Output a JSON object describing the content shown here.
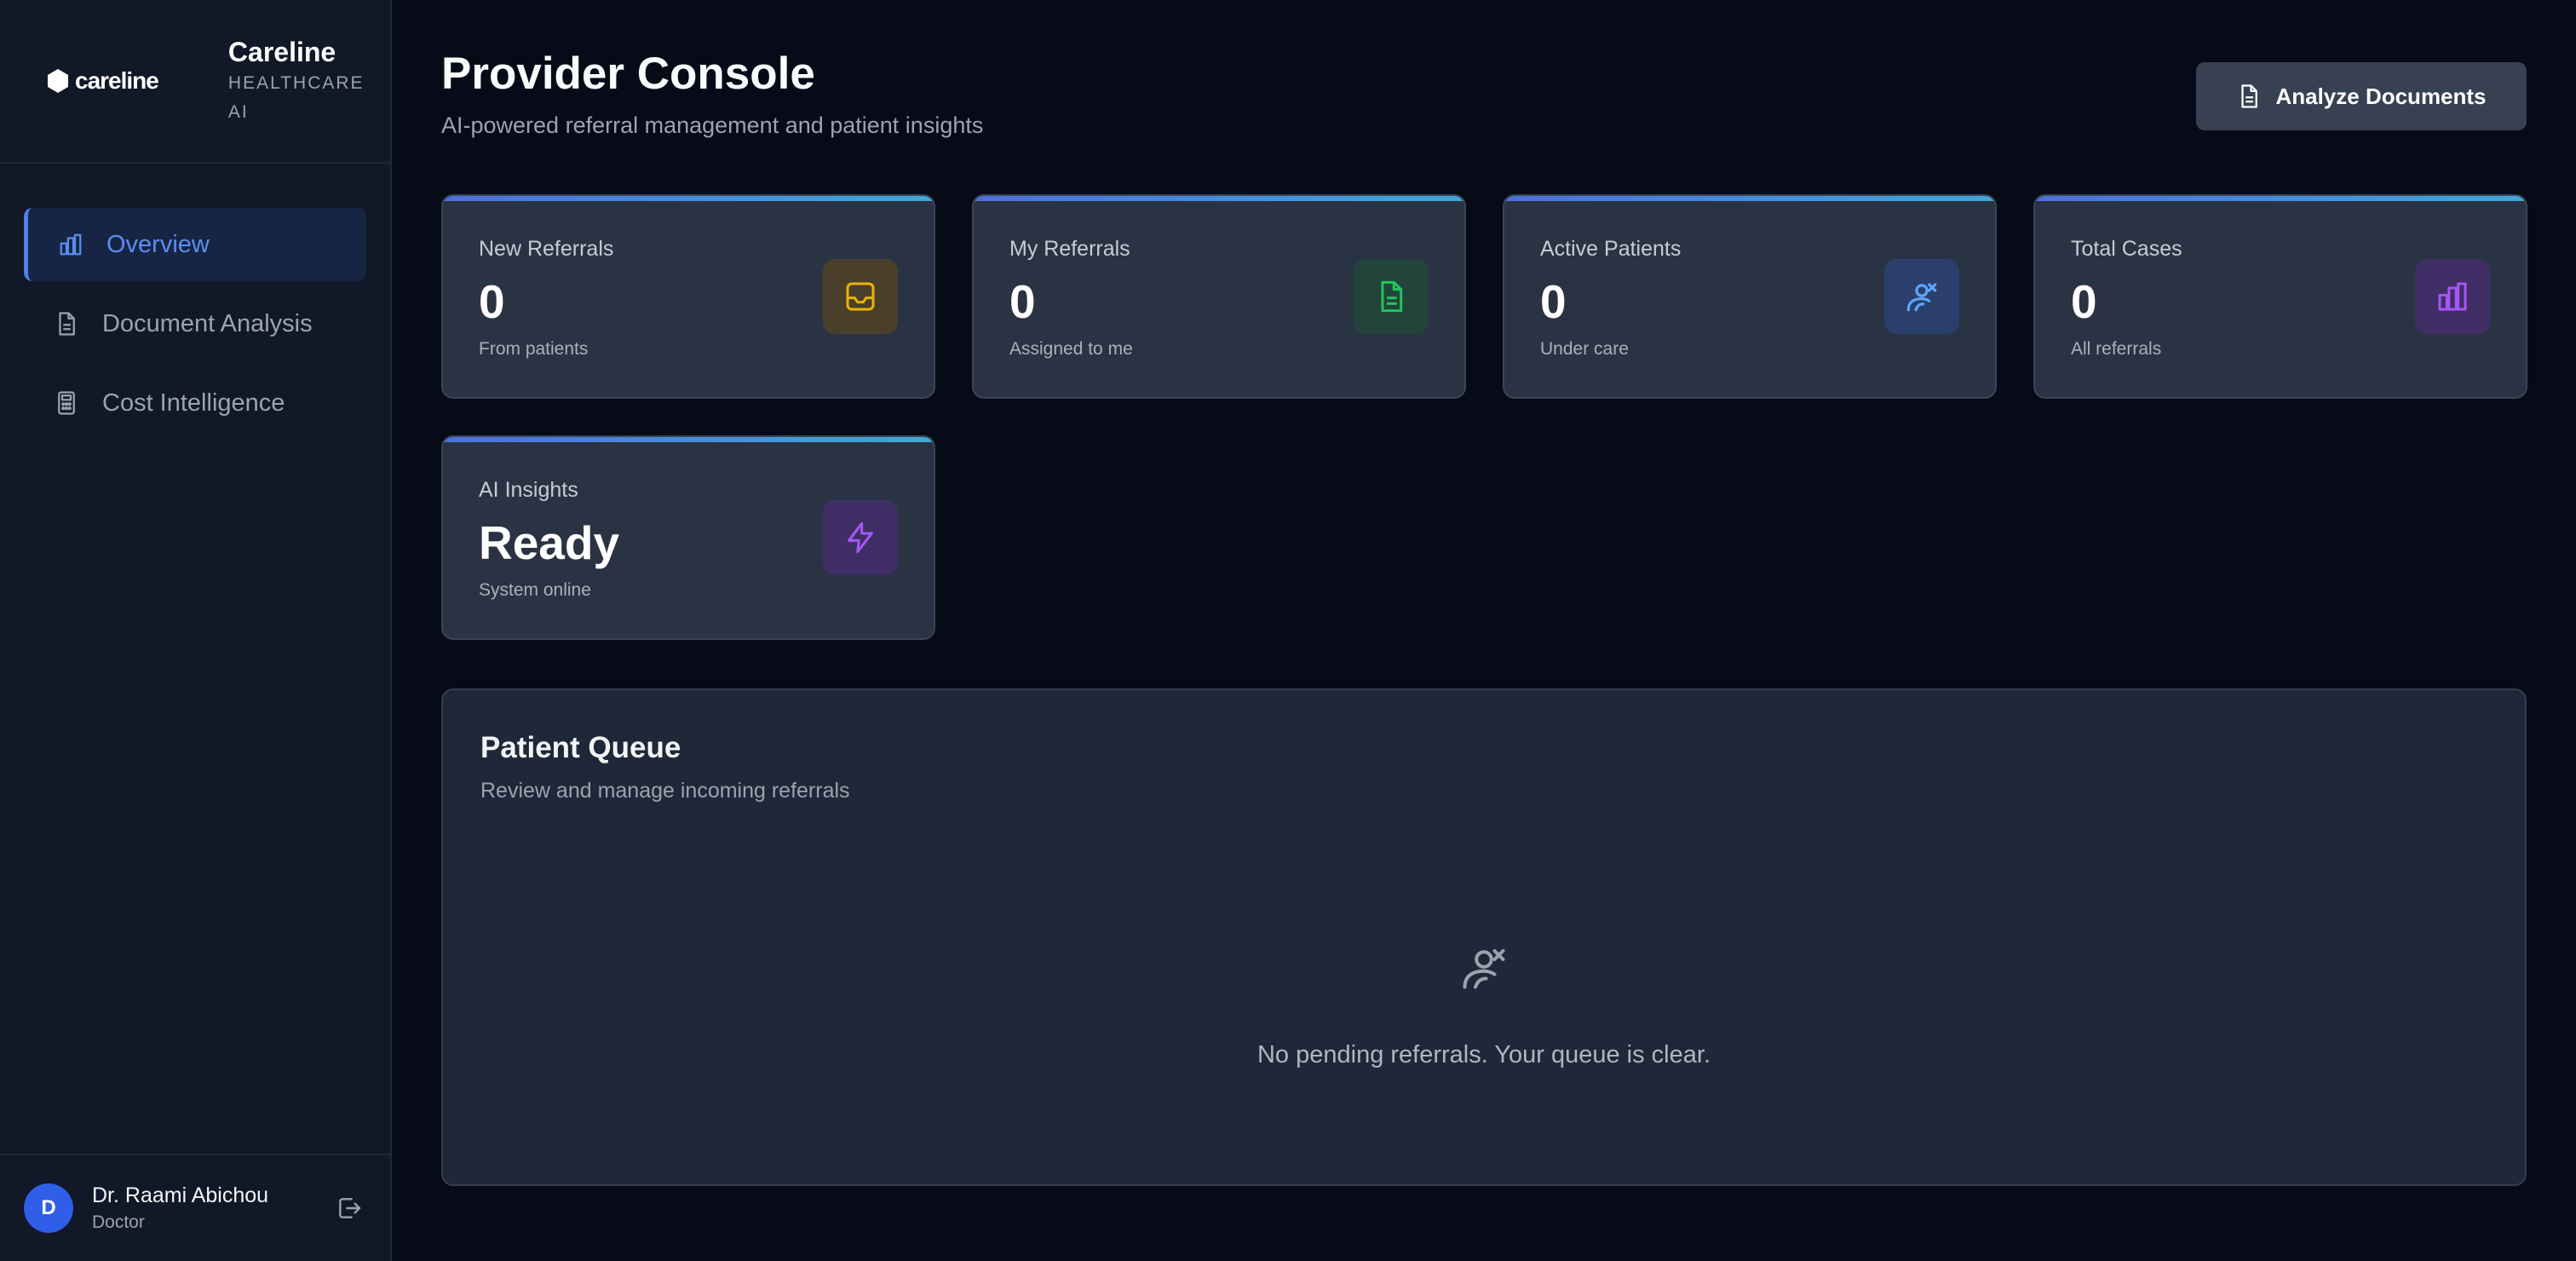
{
  "brand": {
    "logo_text": "careline",
    "name": "Careline",
    "tagline": "HEALTHCARE AI"
  },
  "nav": {
    "items": [
      {
        "label": "Overview",
        "icon": "bar-chart-icon",
        "active": true
      },
      {
        "label": "Document Analysis",
        "icon": "document-icon",
        "active": false
      },
      {
        "label": "Cost Intelligence",
        "icon": "calculator-icon",
        "active": false
      }
    ]
  },
  "user": {
    "initial": "D",
    "name": "Dr. Raami Abichou",
    "role": "Doctor"
  },
  "header": {
    "title": "Provider Console",
    "subtitle": "AI-powered referral management and patient insights",
    "action_label": "Analyze Documents"
  },
  "stats": [
    {
      "label": "New Referrals",
      "value": "0",
      "sub": "From patients",
      "icon": "inbox-icon",
      "color": "#eab308"
    },
    {
      "label": "My Referrals",
      "value": "0",
      "sub": "Assigned to me",
      "icon": "document-icon",
      "color": "#22c55e"
    },
    {
      "label": "Active Patients",
      "value": "0",
      "sub": "Under care",
      "icon": "patient-icon",
      "color": "#60a5fa"
    },
    {
      "label": "Total Cases",
      "value": "0",
      "sub": "All referrals",
      "icon": "bar-chart-icon",
      "color": "#a855f7"
    },
    {
      "label": "AI Insights",
      "value": "Ready",
      "sub": "System online",
      "icon": "lightning-icon",
      "color": "#a855f7"
    }
  ],
  "queue": {
    "title": "Patient Queue",
    "subtitle": "Review and manage incoming referrals",
    "empty_text": "No pending referrals. Your queue is clear."
  },
  "colors": {
    "accent": "#4f7fe8",
    "background": "#070b17",
    "sidebar": "#111827",
    "card": "#2a3343"
  }
}
